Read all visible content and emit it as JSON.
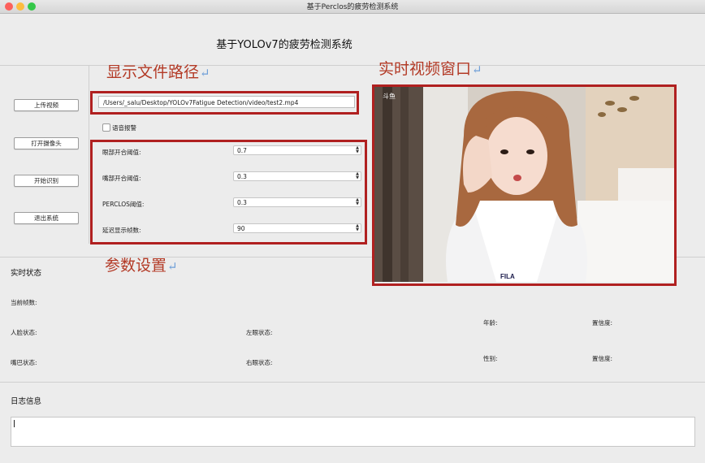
{
  "window": {
    "title": "基于Perclos的疲劳检测系统",
    "traffic_lights": {
      "close": "#fc605c",
      "minimize": "#fdbc40",
      "zoom": "#34c749"
    }
  },
  "app_title": "基于YOLOv7的疲劳检测系统",
  "annotations": {
    "path": "显示文件路径",
    "video": "实时视频窗口",
    "params": "参数设置",
    "return_mark": "↵",
    "color": "#b33a26",
    "box_color": "#b02020"
  },
  "buttons": {
    "upload_video": "上传视频",
    "open_camera": "打开摄像头",
    "start_detect": "开始识别",
    "exit": "退出系统"
  },
  "file_path": "/Users/_salu/Desktop/YOLOv7Fatigue Detection/video/test2.mp4",
  "voice_alarm": {
    "label": "语音报警",
    "checked": false
  },
  "params": [
    {
      "label": "眼部开合阈值:",
      "value": "0.7"
    },
    {
      "label": "嘴部开合阈值:",
      "value": "0.3"
    },
    {
      "label": "PERCLOS阈值:",
      "value": "0.3"
    },
    {
      "label": "延迟显示帧数:",
      "value": "90"
    }
  ],
  "video": {
    "watermark": "斗鱼",
    "brand": "FILA"
  },
  "status": {
    "section_title": "实时状态",
    "current_frame": "当前帧数:",
    "face_state": "人脸状态:",
    "mouth_state": "嘴巴状态:",
    "left_eye": "左眼状态:",
    "right_eye": "右眼状态:",
    "age": "年龄:",
    "gender": "性别:",
    "confidence_age": "置信度:",
    "confidence_gender": "置信度:"
  },
  "log": {
    "section_title": "日志信息",
    "content": ""
  }
}
